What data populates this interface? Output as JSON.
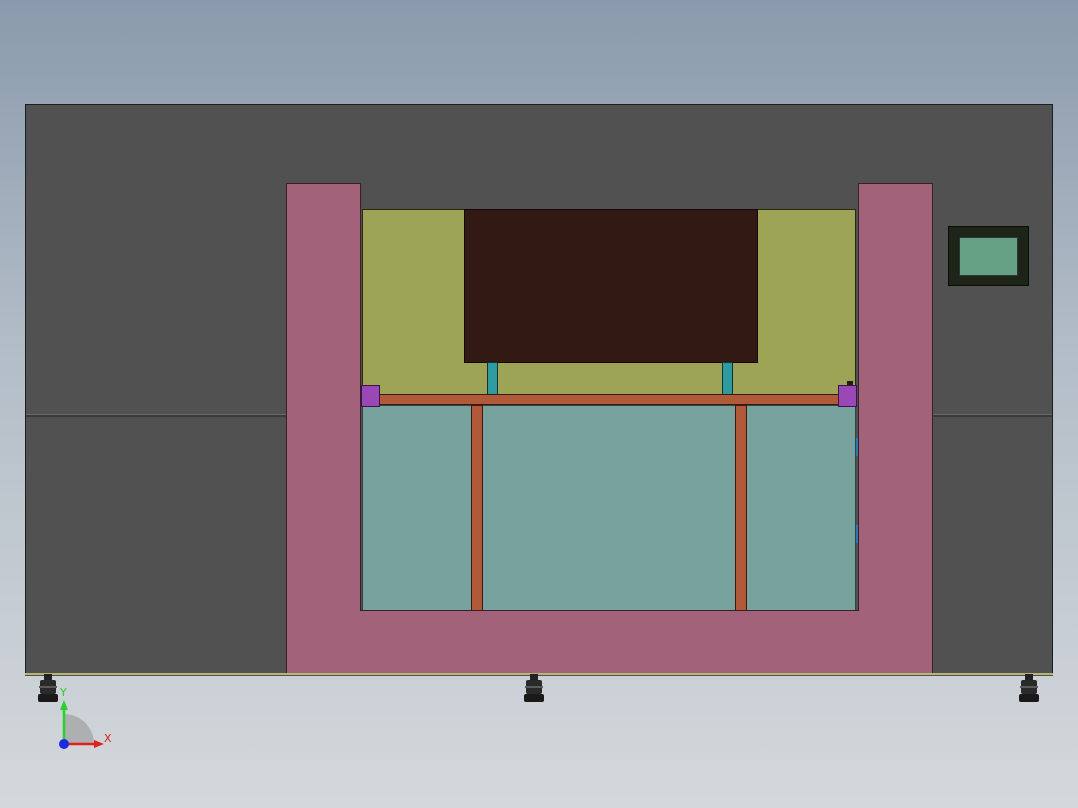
{
  "triad": {
    "x_label": "X",
    "y_label": "Y",
    "x_color": "#e0201a",
    "y_color": "#2ad030",
    "z_color": "#1a2ae0"
  },
  "colors": {
    "background_top": "#8a9aac",
    "cabinet": "#515151",
    "frame": "#a26279",
    "upper_panel": "#9ea456",
    "dark_block": "#331914",
    "lower_panel": "#78a29e",
    "rail": "#b15a3a",
    "post": "#2f9aa0",
    "bracket": "#9a48b6",
    "hmi_screen": "#66a085"
  },
  "icons": [
    "leveling-foot-icon",
    "coordinate-triad-icon"
  ]
}
